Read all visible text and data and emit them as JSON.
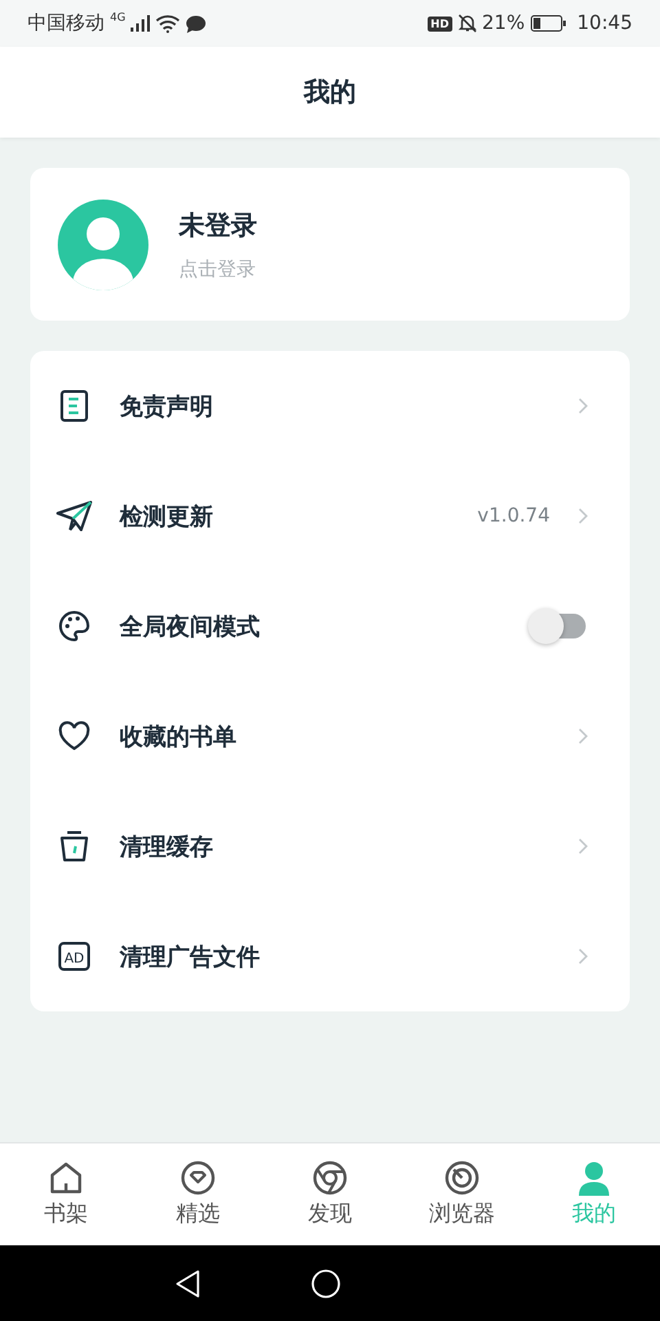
{
  "status_bar": {
    "carrier": "中国移动",
    "network": "4G",
    "hd_badge": "HD",
    "battery": "21%",
    "time": "10:45"
  },
  "header": {
    "title": "我的"
  },
  "profile": {
    "name": "未登录",
    "hint": "点击登录"
  },
  "menu": [
    {
      "kind": "link",
      "label": "免责声明"
    },
    {
      "kind": "link",
      "label": "检测更新",
      "value": "v1.0.74"
    },
    {
      "kind": "toggle",
      "label": "全局夜间模式",
      "on": false
    },
    {
      "kind": "link",
      "label": "收藏的书单"
    },
    {
      "kind": "link",
      "label": "清理缓存"
    },
    {
      "kind": "link",
      "label": "清理广告文件",
      "icon_text": "AD"
    }
  ],
  "tabs": [
    {
      "label": "书架",
      "selected": false
    },
    {
      "label": "精选",
      "selected": false
    },
    {
      "label": "发现",
      "selected": false
    },
    {
      "label": "浏览器",
      "selected": false
    },
    {
      "label": "我的",
      "selected": true
    }
  ]
}
